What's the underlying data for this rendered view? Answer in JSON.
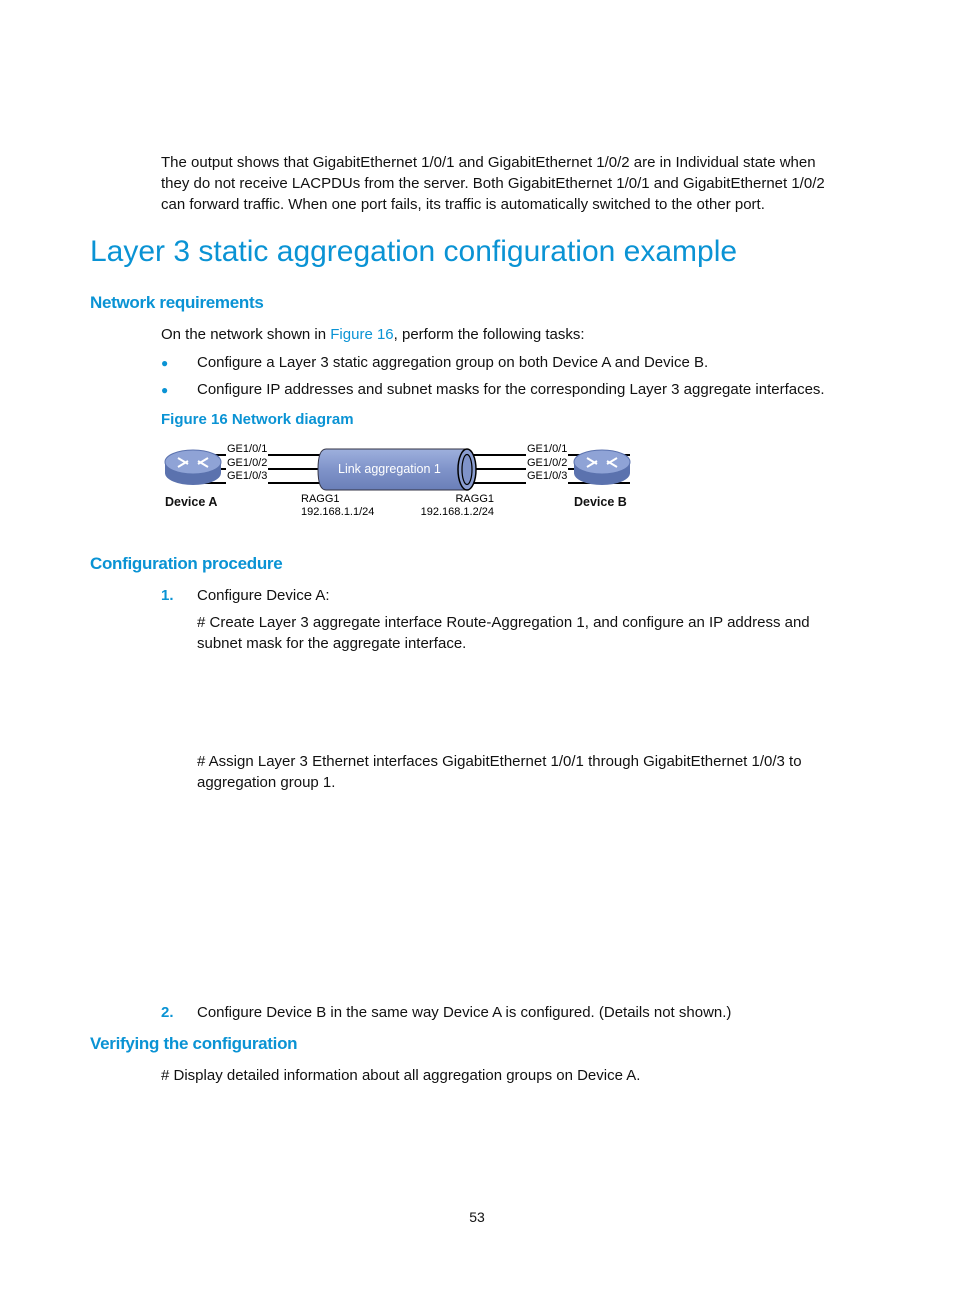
{
  "intro_paragraph": [
    "The output shows that GigabitEthernet 1/0/1 and GigabitEthernet 1/0/2 are in Individual state when",
    "they do not receive LACPDUs from the server. Both GigabitEthernet 1/0/1 and GigabitEthernet 1/0/2",
    "can forward traffic. When one port fails, its traffic is automatically switched to the other port."
  ],
  "section_title": "Layer 3 static aggregation configuration example",
  "network_requirements": {
    "heading": "Network requirements",
    "intro_before": "On the network shown in ",
    "intro_link": "Figure 16",
    "intro_after": ", perform the following tasks:",
    "bullets": [
      "Configure a Layer 3 static aggregation group on both Device A and Device B.",
      "Configure IP addresses and subnet masks for the corresponding Layer 3 aggregate interfaces."
    ]
  },
  "figure": {
    "caption": "Figure 16 Network diagram",
    "link_label": "Link aggregation 1",
    "ports_a": [
      "GE1/0/1",
      "GE1/0/2",
      "GE1/0/3"
    ],
    "ports_b": [
      "GE1/0/1",
      "GE1/0/2",
      "GE1/0/3"
    ],
    "device_a": "Device A",
    "device_b": "Device B",
    "ragg_a": {
      "name": "RAGG1",
      "ip": "192.168.1.1/24"
    },
    "ragg_b": {
      "name": "RAGG1",
      "ip": "192.168.1.2/24"
    },
    "colors": {
      "pipe": "#7f93c9",
      "router": "#6f86c0"
    }
  },
  "configuration_procedure": {
    "heading": "Configuration procedure",
    "step1_num": "1.",
    "step1": "Configure Device A:",
    "step1_comment1": [
      "# Create Layer 3 aggregate interface Route-Aggregation 1, and configure an IP address and",
      "subnet mask for the aggregate interface."
    ],
    "step1_comment2": [
      "# Assign Layer 3 Ethernet interfaces GigabitEthernet 1/0/1 through GigabitEthernet 1/0/3 to",
      "aggregation group 1."
    ],
    "step2_num": "2.",
    "step2": "Configure Device B in the same way Device A is configured. (Details not shown.)"
  },
  "verifying": {
    "heading": "Verifying the configuration",
    "comment": "# Display detailed information about all aggregation groups on Device A."
  },
  "page_number": "53"
}
